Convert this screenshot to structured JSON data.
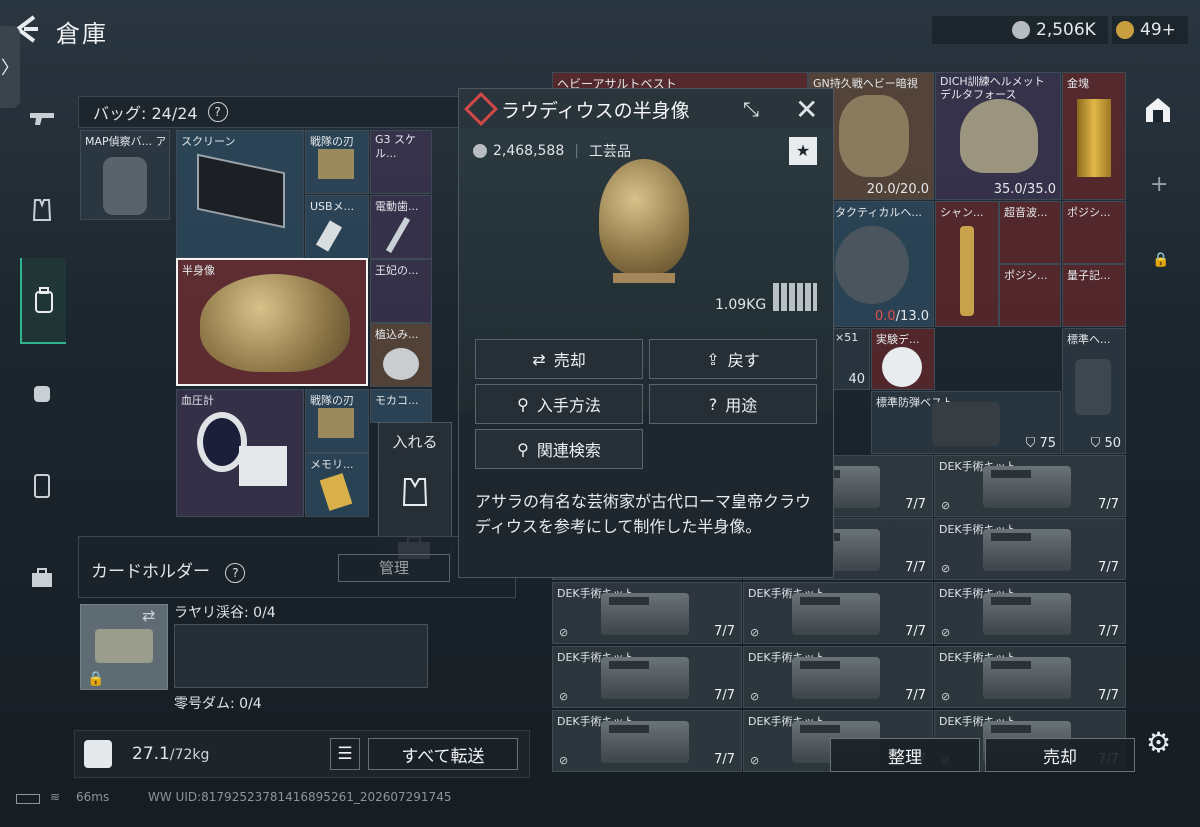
{
  "header": {
    "back": "<",
    "title": "倉庫",
    "currency1": "2,506K",
    "currency2": "49+"
  },
  "sidebar": {
    "handle": "〉"
  },
  "bag": {
    "label": "バッグ: 24/24",
    "help": "?"
  },
  "bag_items": [
    {
      "label": "MAP偵察バ... アサラ",
      "color": "#3a4650"
    },
    {
      "label": "スクリーン"
    },
    {
      "label": "戦隊の刃"
    },
    {
      "label": "G3 スケル..."
    },
    {
      "label": "USBメ..."
    },
    {
      "label": "電動歯..."
    },
    {
      "label": "半身像"
    },
    {
      "label": "王妃の..."
    },
    {
      "label": "植込み..."
    },
    {
      "label": "血圧計"
    },
    {
      "label": "戦隊の刃"
    },
    {
      "label": "モカコ..."
    },
    {
      "label": "メモリ..."
    }
  ],
  "context_menu": {
    "title": "入れる"
  },
  "cardholder": {
    "label": "カードホルダー",
    "help": "?",
    "manage": "管理"
  },
  "keys": {
    "slot1": "ラヤリ渓谷: 0/4",
    "slot2": "零号ダム: 0/4"
  },
  "bottom_left": {
    "weight": "27.1",
    "weight_max": "/72kg",
    "transfer_all": "すべて転送"
  },
  "status": {
    "ping": "66ms",
    "uid": "WW UID:8179252378141689526​1_202607291745"
  },
  "popup": {
    "title": "ラウディウスの半身像",
    "price": "2,468,588",
    "category": "工芸品",
    "weight": "1.09KG",
    "btn_sell": "売却",
    "btn_return": "戻す",
    "btn_obtain": "入手方法",
    "btn_use": "用途",
    "btn_related": "関連検索",
    "description": "アサラの有名な芸術家が古代ローマ皇帝クラウディウスを参考にして制作した半身像。"
  },
  "right_items": {
    "heavy_vest": "ヘビーアサルトベスト",
    "gn": "GN持久戦ヘビー暗視",
    "gn_val": "20.0/20.0",
    "dich": "DICH訓練ヘルメット デルタフォース",
    "dich_val": "35.0/35.0",
    "gold": "金塊",
    "tactical": "タクティカルヘ...",
    "tactical_val": "0.0",
    "tactical_max": "/13.0",
    "champ": "シャン...",
    "ultra": "超音波...",
    "posi1": "ポジシ...",
    "posi2": "ポジシ...",
    "quantum": "量子記...",
    "x51": "×51",
    "x51_cnt": "40",
    "exp": "実験デ...",
    "std_helmet": "標準ヘ...",
    "std_vest": "標準防弾ベスト",
    "std_vest_val": "75",
    "std_helmet_val": "50"
  },
  "med_kits": {
    "label": "DEK手術キット",
    "count": "7/7"
  },
  "bottom_right": {
    "sort": "整理",
    "sell": "売却"
  }
}
